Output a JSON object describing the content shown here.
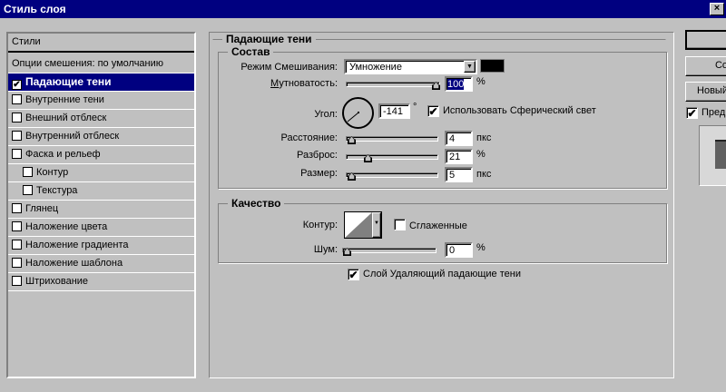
{
  "window": {
    "title": "Стиль слоя",
    "close": "×"
  },
  "sidebar": {
    "header": "Стили",
    "blend_default": "Опции смешения: по умолчанию",
    "items": [
      {
        "label": "Падающие тени",
        "checked": true,
        "selected": true
      },
      {
        "label": "Внутренние тени",
        "checked": false
      },
      {
        "label": "Внешний отблеск",
        "checked": false
      },
      {
        "label": "Внутренний отблеск",
        "checked": false
      },
      {
        "label": "Фаска и рельеф",
        "checked": false
      },
      {
        "label": "Контур",
        "checked": false,
        "indent": true
      },
      {
        "label": "Текстура",
        "checked": false,
        "indent": true
      },
      {
        "label": "Глянец",
        "checked": false
      },
      {
        "label": "Наложение цвета",
        "checked": false
      },
      {
        "label": "Наложение градиента",
        "checked": false
      },
      {
        "label": "Наложение шаблона",
        "checked": false
      },
      {
        "label": "Штрихование",
        "checked": false
      }
    ]
  },
  "main": {
    "title": "Падающие тени",
    "structure": {
      "title": "Состав",
      "blend_mode_label": "Режим Смешивания:",
      "blend_mode_value": "Умножение",
      "shadow_color": "#000000",
      "opacity_label": "Мутноватость:",
      "opacity_value": "100",
      "opacity_unit": "%",
      "opacity_percent": 100,
      "angle_label": "Угол:",
      "angle_value": "-141",
      "angle_unit": "°",
      "global_light_label": "Использовать Сферический свет",
      "global_light_checked": true,
      "distance_label": "Расстояние:",
      "distance_value": "4",
      "distance_unit": "пкс",
      "spread_label": "Разброс:",
      "spread_value": "21",
      "spread_unit": "%",
      "size_label": "Размер:",
      "size_value": "5",
      "size_unit": "пкс"
    },
    "quality": {
      "title": "Качество",
      "contour_label": "Контур:",
      "antialias_label": "Сглаженные",
      "antialias_checked": false,
      "noise_label": "Шум:",
      "noise_value": "0",
      "noise_unit": "%"
    },
    "knockout_label": "Слой Удаляющий падающие тени",
    "knockout_checked": true
  },
  "right": {
    "btn1": "",
    "btn2": "Со",
    "btn3": "Новый",
    "preview_label": "Пред",
    "preview_checked": true
  }
}
